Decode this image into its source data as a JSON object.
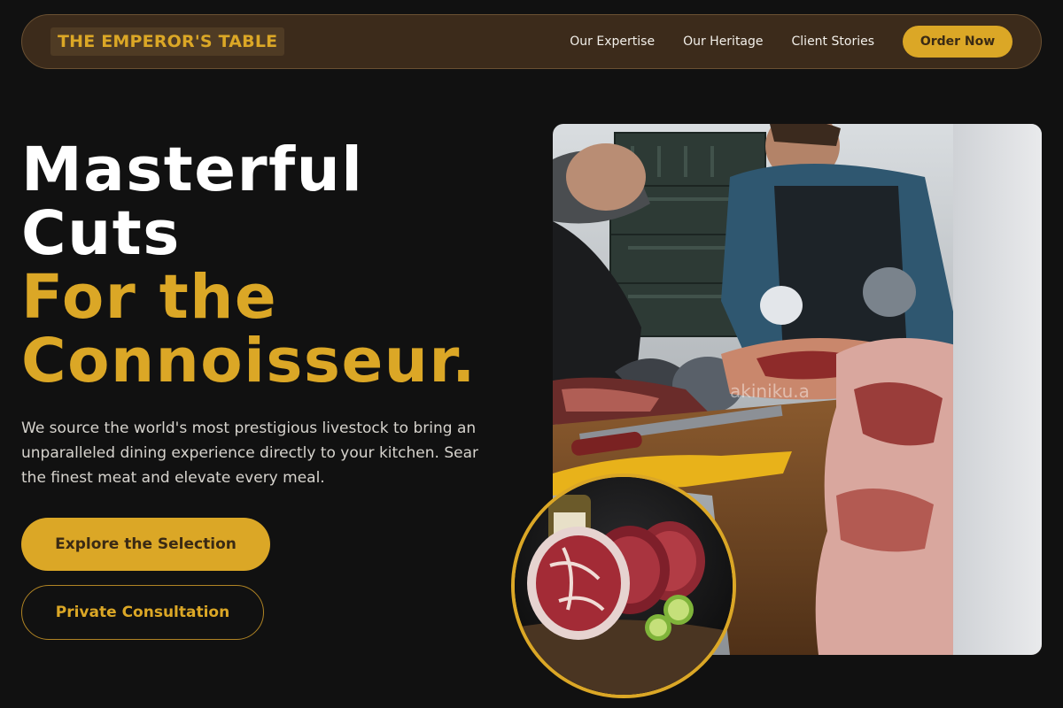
{
  "nav": {
    "logo": "THE EMPEROR'S TABLE",
    "links": [
      "Our Expertise",
      "Our Heritage",
      "Client Stories"
    ],
    "cta": "Order Now"
  },
  "hero": {
    "title_line1": "Masterful",
    "title_line2": "Cuts",
    "title_line3": "For the",
    "title_line4": "Connoisseur.",
    "description": "We source the world's most prestigious livestock to bring an unparalleled dining experience directly to your kitchen. Sear the finest meat and elevate every meal.",
    "primary_button": "Explore the Selection",
    "secondary_button": "Private Consultation"
  },
  "images": {
    "main_alt": "Butchers carving meat on a wooden block",
    "main_watermark": "akiniku.a",
    "steak_alt": "Raw marbled steaks with lime on a wooden board"
  },
  "colors": {
    "accent": "#dba726",
    "background": "#111111",
    "nav_background": "#3c2b1b"
  }
}
